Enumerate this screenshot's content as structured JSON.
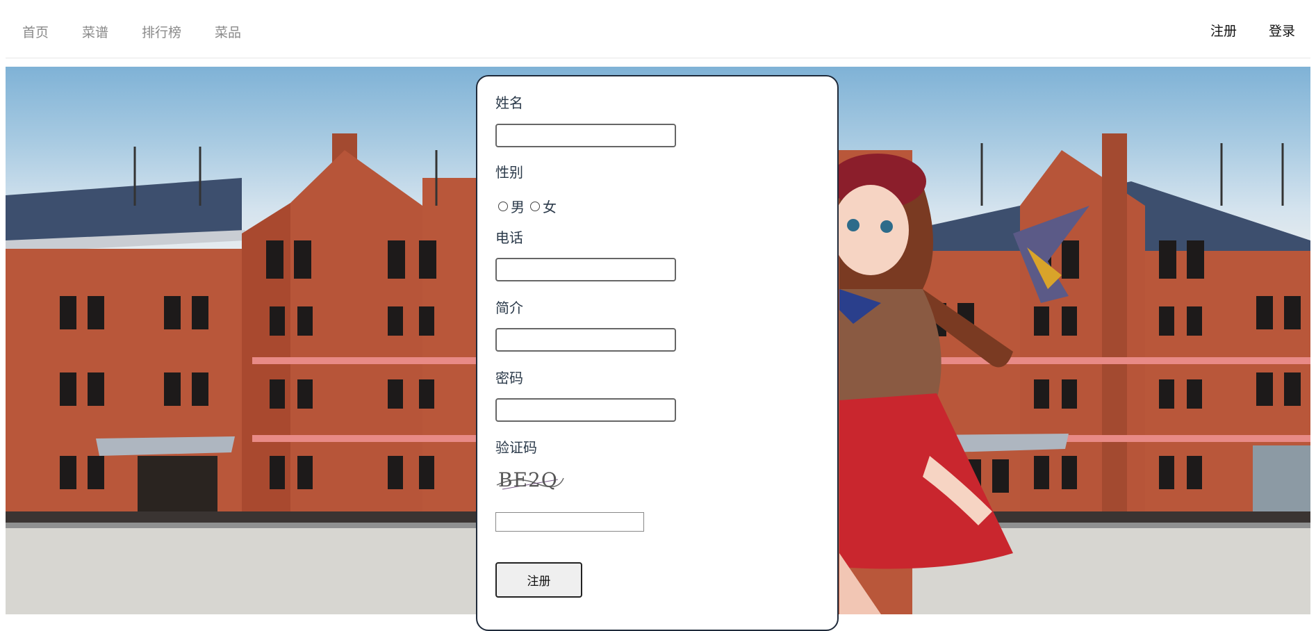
{
  "nav": {
    "items": [
      {
        "label": "首页"
      },
      {
        "label": "菜谱"
      },
      {
        "label": "排行榜"
      },
      {
        "label": "菜品"
      }
    ],
    "register_label": "注册",
    "login_label": "登录"
  },
  "form": {
    "name_label": "姓名",
    "name_value": "",
    "gender_label": "性别",
    "gender_options": [
      {
        "label": "男",
        "selected": false
      },
      {
        "label": "女",
        "selected": false
      }
    ],
    "phone_label": "电话",
    "phone_value": "",
    "bio_label": "简介",
    "bio_value": "",
    "password_label": "密码",
    "password_value": "",
    "captcha_label": "验证码",
    "captcha_text": "BE2Q",
    "captcha_value": "",
    "submit_label": "注册"
  },
  "colors": {
    "nav_muted": "#8a8a8a",
    "card_border": "#1f2a3a",
    "brick": "#b9573a"
  }
}
